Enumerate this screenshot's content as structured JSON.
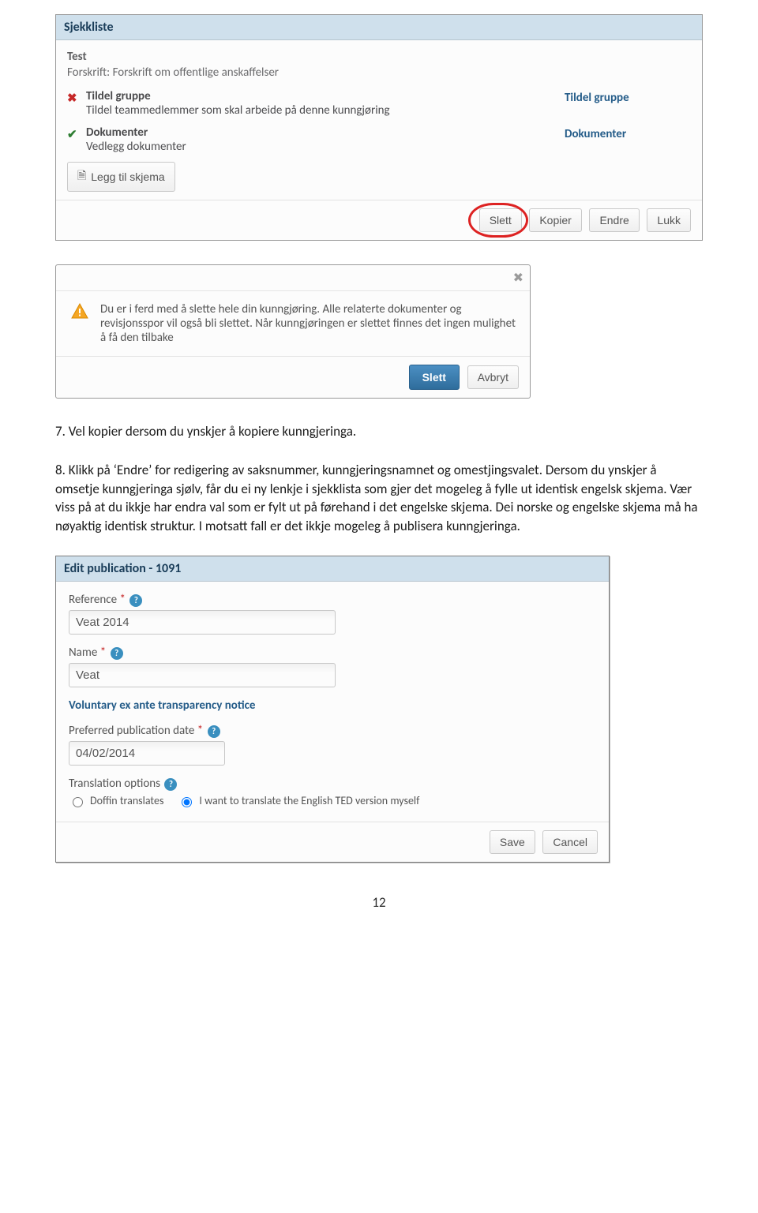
{
  "screenshots": {
    "checklist": {
      "panel_title": "Sjekkliste",
      "test_name": "Test",
      "forskrift": "Forskrift: Forskrift om offentlige anskaffelser",
      "items": [
        {
          "status_icon": "cross",
          "title": "Tildel gruppe",
          "desc": "Tildel teammedlemmer som skal arbeide på denne kunngjøring",
          "action_label": "Tildel gruppe"
        },
        {
          "status_icon": "check",
          "title": "Dokumenter",
          "desc": "Vedlegg dokumenter",
          "action_label": "Dokumenter"
        }
      ],
      "add_form_label": "Legg til skjema",
      "buttons": {
        "slett": "Slett",
        "kopier": "Kopier",
        "endre": "Endre",
        "lukk": "Lukk"
      }
    },
    "confirm_dialog": {
      "message": "Du er i ferd med å slette hele din kunngjøring. Alle relaterte dokumenter og revisjonsspor vil også bli slettet. Når kunngjøringen er slettet finnes det ingen mulighet å få den tilbake",
      "primary_btn": "Slett",
      "cancel_btn": "Avbryt"
    },
    "edit_form": {
      "panel_title": "Edit publication - 1091",
      "reference_label": "Reference",
      "reference_value": "Veat 2014",
      "name_label": "Name",
      "name_value": "Veat",
      "section_title": "Voluntary ex ante transparency notice",
      "pubdate_label": "Preferred publication date",
      "pubdate_value": "04/02/2014",
      "trans_opts_label": "Translation options",
      "radio_doffin": "Doffin translates",
      "radio_self": "I want to translate the English TED version myself",
      "buttons": {
        "save": "Save",
        "cancel": "Cancel"
      }
    }
  },
  "body_text": {
    "line7": "7. Vel kopier dersom du ynskjer å kopiere kunngjeringa.",
    "line8": "8. Klikk på ‘Endre’ for redigering av saksnummer,  kunngjeringsnamnet og omestjingsvalet. Dersom du ynskjer å omsetje kunngjeringa sjølv, får du ei ny lenkje i sjekklista som gjer det mogeleg å fylle ut identisk engelsk skjema. Vær viss på at du ikkje har endra val som er fylt ut på førehand i det engelske skjema. Dei norske og engelske skjema må ha nøyaktig identisk struktur. I motsatt fall er det ikkje mogeleg å  publisera kunngjeringa."
  },
  "page_number": "12"
}
